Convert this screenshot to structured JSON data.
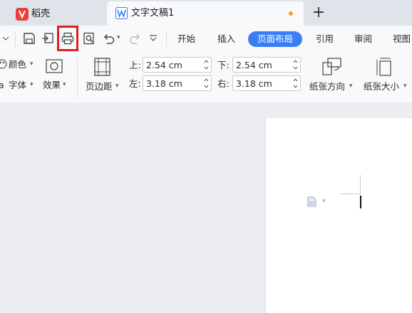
{
  "tabs": {
    "wps_label": "稻壳",
    "doc_label": "文字文稿1",
    "new_tab": "+"
  },
  "menu": {
    "items": [
      "开始",
      "插入",
      "页面布局",
      "引用",
      "审阅",
      "视图"
    ]
  },
  "ribbon": {
    "color_label": "颜色",
    "font_label": "字体",
    "effect_label": "效果",
    "margin_label": "页边距",
    "top_label": "上:",
    "top_value": "2.54 cm",
    "bottom_label": "下:",
    "bottom_value": "2.54 cm",
    "left_label": "左:",
    "left_value": "3.18 cm",
    "right_label": "右:",
    "right_value": "3.18 cm",
    "orientation_label": "纸张方向",
    "size_label": "纸张大小"
  },
  "colors": {
    "accent": "#3a7ef6",
    "highlight_box": "#e02020",
    "unsaved_dot": "#f0a020",
    "wps_logo": "#e8403a"
  }
}
